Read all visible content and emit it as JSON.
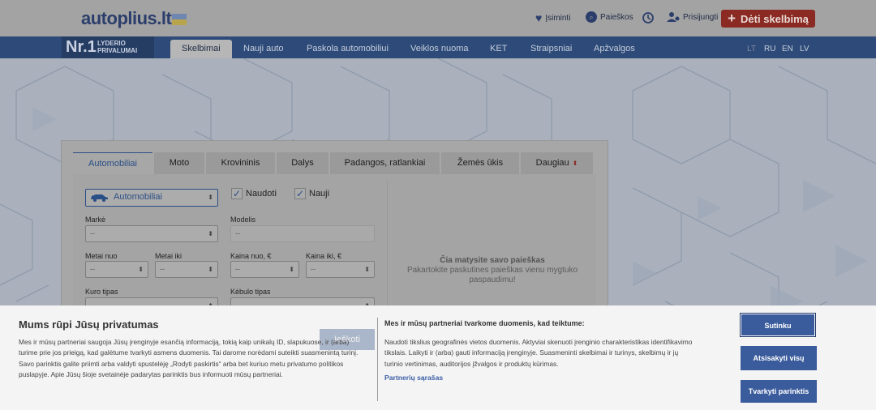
{
  "header": {
    "logo_text": "autoplius.lt",
    "remembered": "Įsiminti",
    "searches": "Paieškos",
    "login": "Prisijungti",
    "post_ad": "Dėti skelbimą"
  },
  "badge": {
    "big": "Nr.1",
    "line1": "LYDERIO",
    "line2": "PRIVALUMAI"
  },
  "nav": {
    "items": [
      "Skelbimai",
      "Nauji auto",
      "Paskola automobiliui",
      "Veiklos nuoma",
      "KET",
      "Straipsniai",
      "Apžvalgos"
    ],
    "languages": [
      "LT",
      "RU",
      "EN",
      "LV"
    ]
  },
  "search": {
    "tabs": [
      "Automobiliai",
      "Moto",
      "Krovininis",
      "Dalys",
      "Padangos, ratlankiai",
      "Žemės ūkis",
      "Daugiau"
    ],
    "category": "Automobiliai",
    "used_label": "Naudoti",
    "new_label": "Nauji",
    "make_label": "Markė",
    "model_label": "Modelis",
    "year_from_label": "Metai nuo",
    "year_to_label": "Metai iki",
    "price_from_label": "Kaina nuo, €",
    "price_to_label": "Kaina iki, €",
    "fuel_label": "Kuro tipas",
    "body_label": "Kėbulo tipas",
    "empty_option": "--",
    "search_button": "Ieškoti",
    "hint_title": "Čia matysite savo paieškas",
    "hint_body": "Pakartokite paskutines paieškas vienu mygtuko paspaudimu!"
  },
  "cookie": {
    "title": "Mums rūpi Jūsų privatumas",
    "text": "Mes ir mūsų partneriai saugoja Jūsų įrenginyje esančią informaciją, tokią kaip unikalų ID, slapukuose, ir (arba) turime prie jos prieigą, kad galėtume tvarkyti asmens duomenis. Tai darome norėdami suteikti suasmenintą turinį. Savo parinktis galite priimti arba valdyti spustelėję „Rodyti paskirtis“ arba bet kuriuo metu privatumo politikos puslapyje. Apie Jūsų šioje svetainėje padarytas parinktis bus informuoti mūsų partneriai.",
    "title2": "Mes ir mūsų partneriai tvarkome duomenis, kad teiktume:",
    "text2": "Naudoti tikslius geografinės vietos duomenis. Aktyviai skenuoti įrenginio charakteristikas identifikavimo tikslais. Laikyti ir (arba) gauti informaciją įrenginyje. Suasmeninti skelbimai ir turinys, skelbimų ir jų turinio vertinimas, auditorijos įžvalgos ir produktų kūrimas.",
    "partners_link": "Partnerių sąrašas",
    "accept": "Sutinku",
    "reject": "Atsisakyti visų",
    "manage": "Tvarkyti parinktis"
  }
}
